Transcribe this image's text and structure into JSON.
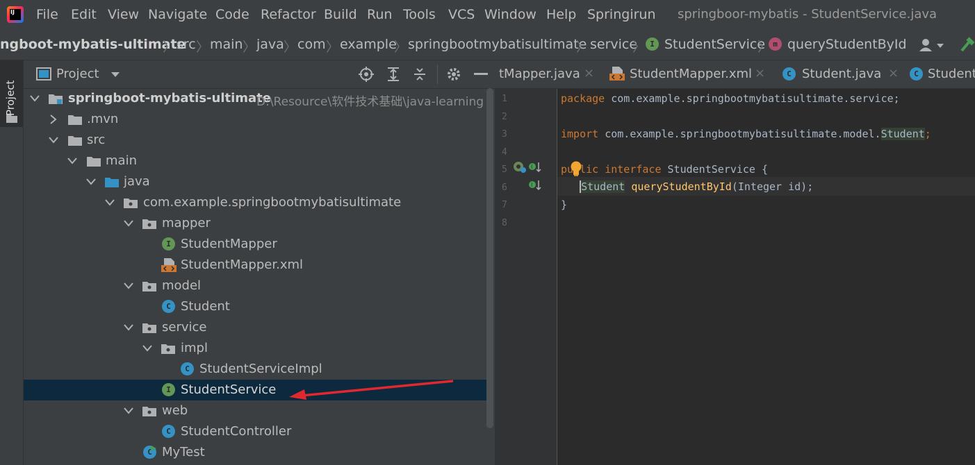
{
  "app": {
    "window_title": "springboor-mybatis - StudentService.java",
    "menu": [
      "File",
      "Edit",
      "View",
      "Navigate",
      "Code",
      "Refactor",
      "Build",
      "Run",
      "Tools",
      "VCS",
      "Window",
      "Help",
      "Springirun"
    ]
  },
  "breadcrumb": [
    "ngboot-mybatis-ultimate",
    "src",
    "main",
    "java",
    "com",
    "example",
    "springbootmybatisultimate",
    "service",
    "StudentService",
    "queryStudentById"
  ],
  "project_panel": {
    "title": "Project",
    "tool_tab_label": "Project",
    "root_path": "D:\\Resource\\软件技术基础\\java-learning",
    "tree": [
      {
        "label": "springboot-mybatis-ultimate",
        "type": "module"
      },
      {
        "label": ".mvn",
        "type": "folder"
      },
      {
        "label": "src",
        "type": "folder"
      },
      {
        "label": "main",
        "type": "folder"
      },
      {
        "label": "java",
        "type": "source-folder"
      },
      {
        "label": "com.example.springbootmybatisultimate",
        "type": "package"
      },
      {
        "label": "mapper",
        "type": "package"
      },
      {
        "label": "StudentMapper",
        "type": "interface"
      },
      {
        "label": "StudentMapper.xml",
        "type": "xml"
      },
      {
        "label": "model",
        "type": "package"
      },
      {
        "label": "Student",
        "type": "class"
      },
      {
        "label": "service",
        "type": "package"
      },
      {
        "label": "impl",
        "type": "package"
      },
      {
        "label": "StudentServiceImpl",
        "type": "class"
      },
      {
        "label": "StudentService",
        "type": "interface",
        "selected": true
      },
      {
        "label": "web",
        "type": "package"
      },
      {
        "label": "StudentController",
        "type": "class"
      },
      {
        "label": "MyTest",
        "type": "test"
      }
    ]
  },
  "editor_tabs": [
    {
      "label": "tMapper.java"
    },
    {
      "label": "StudentMapper.xml"
    },
    {
      "label": "Student.java"
    },
    {
      "label": "Student"
    }
  ],
  "editor": {
    "line_numbers": [
      "1",
      "2",
      "3",
      "4",
      "5",
      "6",
      "7",
      "8"
    ],
    "lines": [
      {
        "kw": "package",
        "rest": " com.example.springbootmybatisultimate.service;"
      },
      {
        "kw": "import",
        "rest": " com.example.springbootmybatisultimate.model.",
        "hl": "Student",
        ";": ";"
      },
      {
        "kw": "public interface",
        "rest": " StudentService {"
      },
      {
        "type": "Student",
        "fn": "queryStudentById",
        "rest": "(Integer id);"
      },
      {
        "rest": "}"
      }
    ]
  },
  "colors": {
    "accent_selected": "#0d293e",
    "arrow": "#e0282e",
    "interface_icon": "#629755",
    "class_icon": "#3592c4"
  }
}
